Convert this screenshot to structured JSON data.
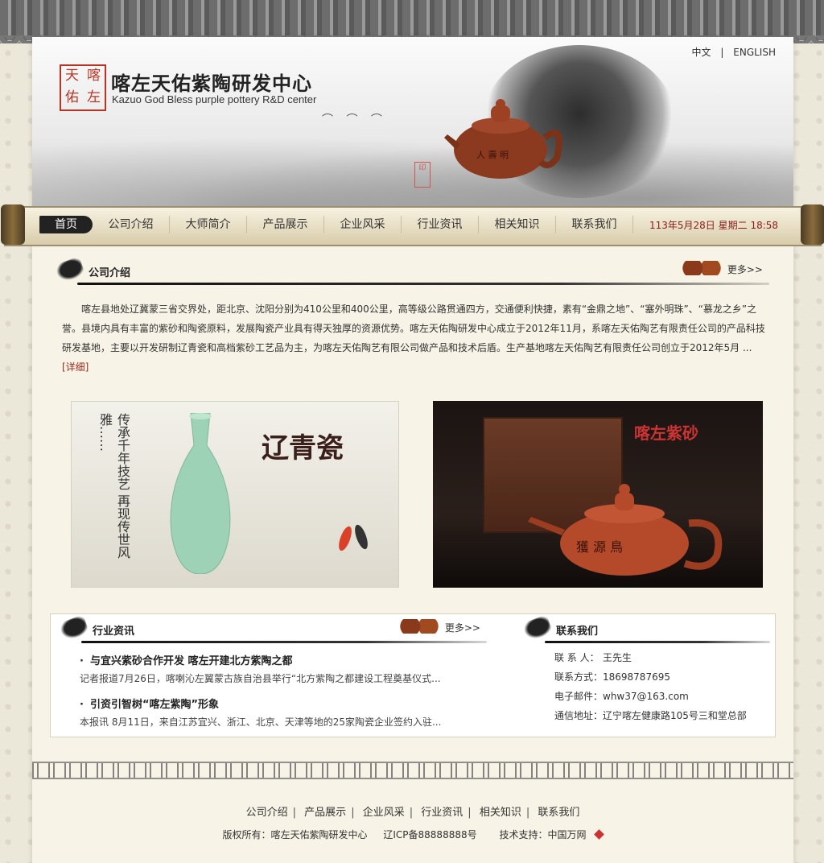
{
  "lang": {
    "cn": "中文",
    "sep": "|",
    "en": "ENGLISH"
  },
  "brand": {
    "seal_chars": [
      "天",
      "喀",
      "佑",
      "左"
    ],
    "title_cn": "喀左天佑紫陶研发中心",
    "title_en": "Kazuo God Bless purple pottery R&D center"
  },
  "nav": {
    "items": [
      "首页",
      "公司介绍",
      "大师简介",
      "产品展示",
      "企业风采",
      "行业资讯",
      "相关知识",
      "联系我们"
    ],
    "date": "113年5月28日 星期二 18:58"
  },
  "company": {
    "title": "公司介绍",
    "more": "更多>>",
    "text": "喀左县地处辽冀蒙三省交界处，距北京、沈阳分别为410公里和400公里，高等级公路贯通四方，交通便利快捷，素有“金鼎之地”、“塞外明珠”、“慕龙之乡”之誉。县境内具有丰富的紫砂和陶瓷原料，发展陶瓷产业具有得天独厚的资源优势。喀左天佑陶研发中心成立于2012年11月，系喀左天佑陶艺有限责任公司的产品科技研发基地，主要以开发研制辽青瓷和高档紫砂工艺品为主，为喀左天佑陶艺有限公司做产品和技术后盾。生产基地喀左天佑陶艺有限责任公司创立于2012年5月 ...",
    "detail": "[详细]"
  },
  "images": {
    "img1_title": "辽青瓷",
    "img1_vertical": "传承千年技艺 再现传世风雅……",
    "img2_title": "喀左紫砂",
    "img2_pot_text": "獲 源 鳥"
  },
  "news": {
    "title": "行业资讯",
    "more": "更多>>",
    "items": [
      {
        "title": "与宜兴紫砂合作开发 喀左开建北方紫陶之都",
        "desc": "记者报道7月26日，喀喇沁左翼蒙古族自治县举行“北方紫陶之都建设工程奠基仪式..."
      },
      {
        "title": "引资引智树“喀左紫陶”形象",
        "desc": "本报讯 8月11日，来自江苏宜兴、浙江、北京、天津等地的25家陶瓷企业签约入驻..."
      }
    ]
  },
  "contact": {
    "title": "联系我们",
    "rows": [
      {
        "k": "联 系 人：",
        "v": "王先生"
      },
      {
        "k": "联系方式：",
        "v": "18698787695"
      },
      {
        "k": "电子邮件：",
        "v": "whw37@163.com"
      },
      {
        "k": "通信地址：",
        "v": "辽宁喀左健康路105号三和堂总部"
      }
    ]
  },
  "footer": {
    "links": [
      "公司介绍",
      "产品展示",
      "企业风采",
      "行业资讯",
      "相关知识",
      "联系我们"
    ],
    "sep": "|",
    "copyright": "版权所有：喀左天佑紫陶研发中心",
    "icp": "辽ICP备88888888号",
    "support": "技术支持：中国万网"
  }
}
